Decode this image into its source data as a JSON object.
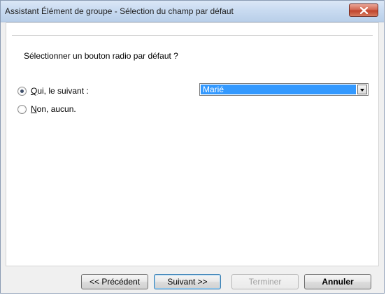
{
  "window": {
    "title": "Assistant Élément de groupe - Sélection du champ par défaut"
  },
  "content": {
    "prompt": "Sélectionner un bouton radio par défaut ?",
    "radio_yes": {
      "label": "Qui, le suivant :",
      "checked": true
    },
    "radio_no": {
      "label": "Non, aucun.",
      "checked": false
    },
    "default_field": {
      "selected": "Marié"
    }
  },
  "buttons": {
    "previous_prefix": "<< ",
    "previous": "Précédent",
    "next": "Suivant >>",
    "finish": "Terminer",
    "cancel": "Annuler"
  },
  "icons": {
    "close": "close-icon",
    "dropdown": "chevron-down-icon"
  },
  "colors": {
    "selection": "#3399ff",
    "close_button": "#c0432c",
    "titlebar": "#c9dbf1"
  }
}
